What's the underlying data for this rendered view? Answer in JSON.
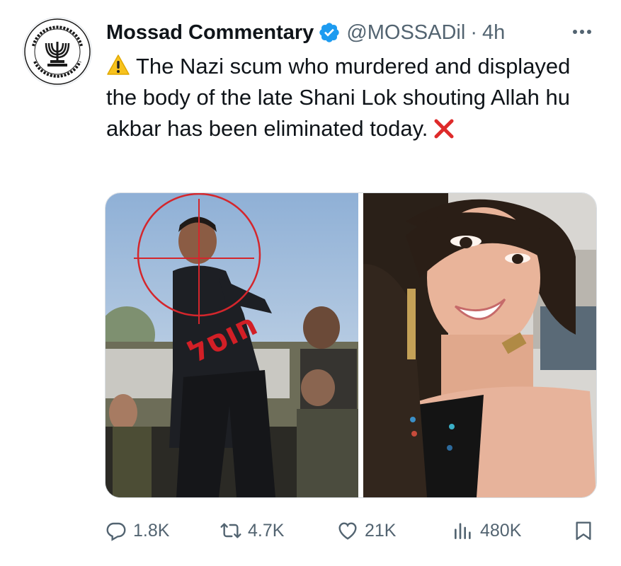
{
  "author": {
    "display_name": "Mossad Commentary",
    "handle": "@MOSSADil",
    "separator": "·",
    "time": "4h",
    "avatar_icon": "mossad-seal-icon",
    "verified_color": "#1d9bf0"
  },
  "tweet": {
    "text": "The Nazi scum who murdered and displayed the body of the late Shani Lok shouting Allah hu akbar has been eliminated today.",
    "leading_emoji": "warning-icon",
    "trailing_emoji": "red-x-icon"
  },
  "media": {
    "photos": [
      {
        "icon": "crosshair-photo",
        "overlay_text": "חוסל",
        "overlay_color": "#d21f26"
      },
      {
        "icon": "portrait-photo"
      }
    ]
  },
  "actions": {
    "replies": "1.8K",
    "reposts": "4.7K",
    "likes": "21K",
    "views": "480K"
  },
  "colors": {
    "text_primary": "#0f1419",
    "text_secondary": "#536471",
    "accent": "#1d9bf0"
  }
}
